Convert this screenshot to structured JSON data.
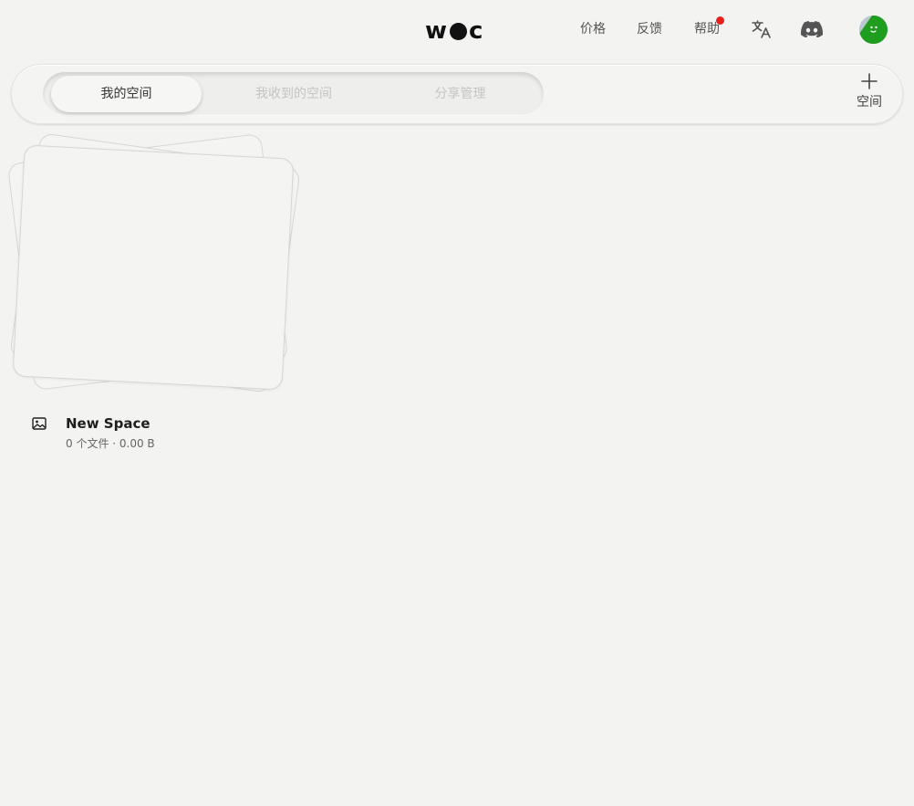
{
  "header": {
    "logo_left": "w",
    "logo_right": "c",
    "nav": {
      "pricing": "价格",
      "feedback": "反馈",
      "help": "帮助"
    },
    "icons": [
      "translate-icon",
      "discord-icon"
    ],
    "help_badge_color": "#e8201a",
    "avatar_color": "#1f9d1f"
  },
  "tabs": {
    "items": [
      {
        "label": "我的空间",
        "active": true
      },
      {
        "label": "我收到的空间",
        "active": false
      },
      {
        "label": "分享管理",
        "active": false
      }
    ]
  },
  "actions": {
    "new_space_label": "空间"
  },
  "spaces": [
    {
      "name": "New Space",
      "info": "0 个文件 · 0.00 B",
      "icon": "image-icon"
    }
  ]
}
